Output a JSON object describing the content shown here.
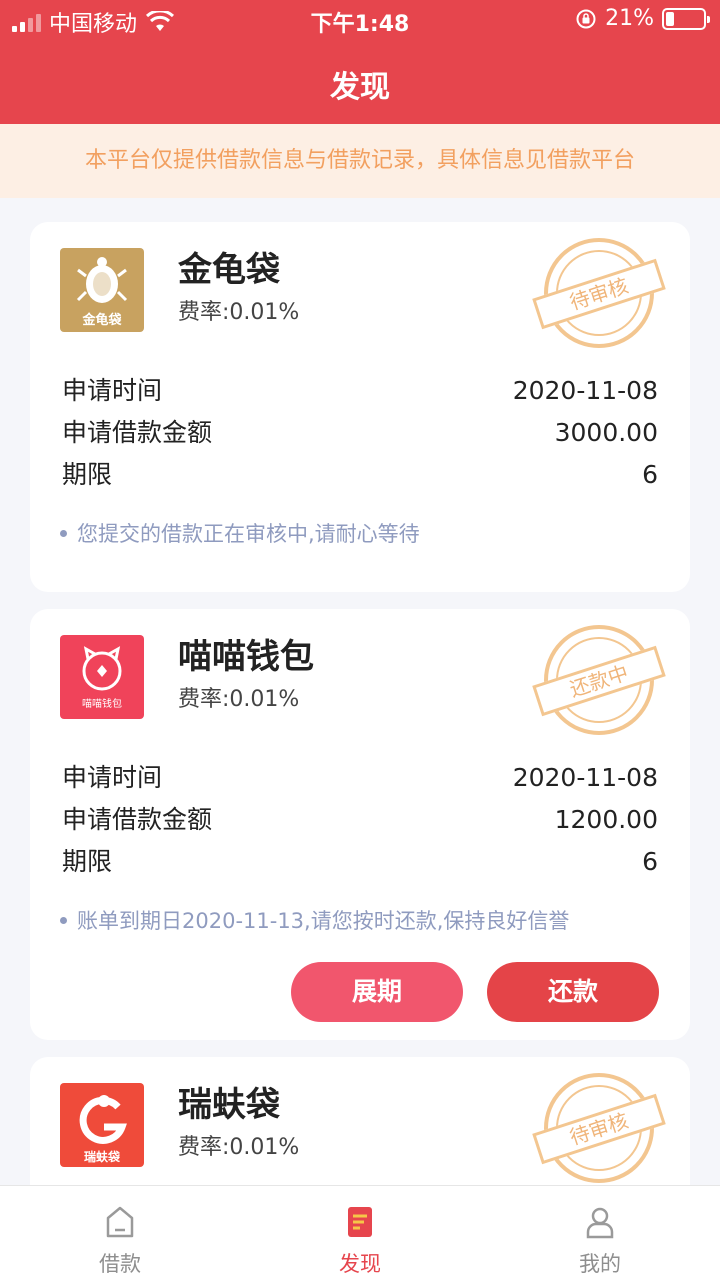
{
  "status_bar": {
    "carrier": "中国移动",
    "time": "下午1:48",
    "battery": "21%"
  },
  "header": {
    "title": "发现"
  },
  "notice": "本平台仅提供借款信息与借款记录，具体信息见借款平台",
  "labels": {
    "apply_time": "申请时间",
    "apply_amount": "申请借款金额",
    "term": "期限",
    "rate_prefix": "费率:"
  },
  "cards": [
    {
      "name": "金龟袋",
      "rate": "费率:0.01%",
      "status": "待审核",
      "logo_text": "金龟袋",
      "apply_time": "2020-11-08",
      "amount": "3000.00",
      "term": "6",
      "note": "您提交的借款正在审核中,请耐心等待"
    },
    {
      "name": "喵喵钱包",
      "rate": "费率:0.01%",
      "status": "还款中",
      "logo_text": "喵喵钱包",
      "apply_time": "2020-11-08",
      "amount": "1200.00",
      "term": "6",
      "note": "账单到期日2020-11-13,请您按时还款,保持良好信誉",
      "buttons": {
        "extend": "展期",
        "repay": "还款"
      }
    },
    {
      "name": "瑞蚨袋",
      "rate": "费率:0.01%",
      "status": "待审核",
      "logo_text": "瑞蚨袋"
    }
  ],
  "tabbar": [
    {
      "label": "借款",
      "icon": "loan-icon",
      "active": false
    },
    {
      "label": "发现",
      "icon": "discover-icon",
      "active": true
    },
    {
      "label": "我的",
      "icon": "profile-icon",
      "active": false
    }
  ],
  "colors": {
    "primary": "#e6454d",
    "notice_bg": "#fdefe4",
    "notice_text": "#f2a060",
    "stamp": "#f3c690",
    "note_text": "#8f9bbf"
  }
}
